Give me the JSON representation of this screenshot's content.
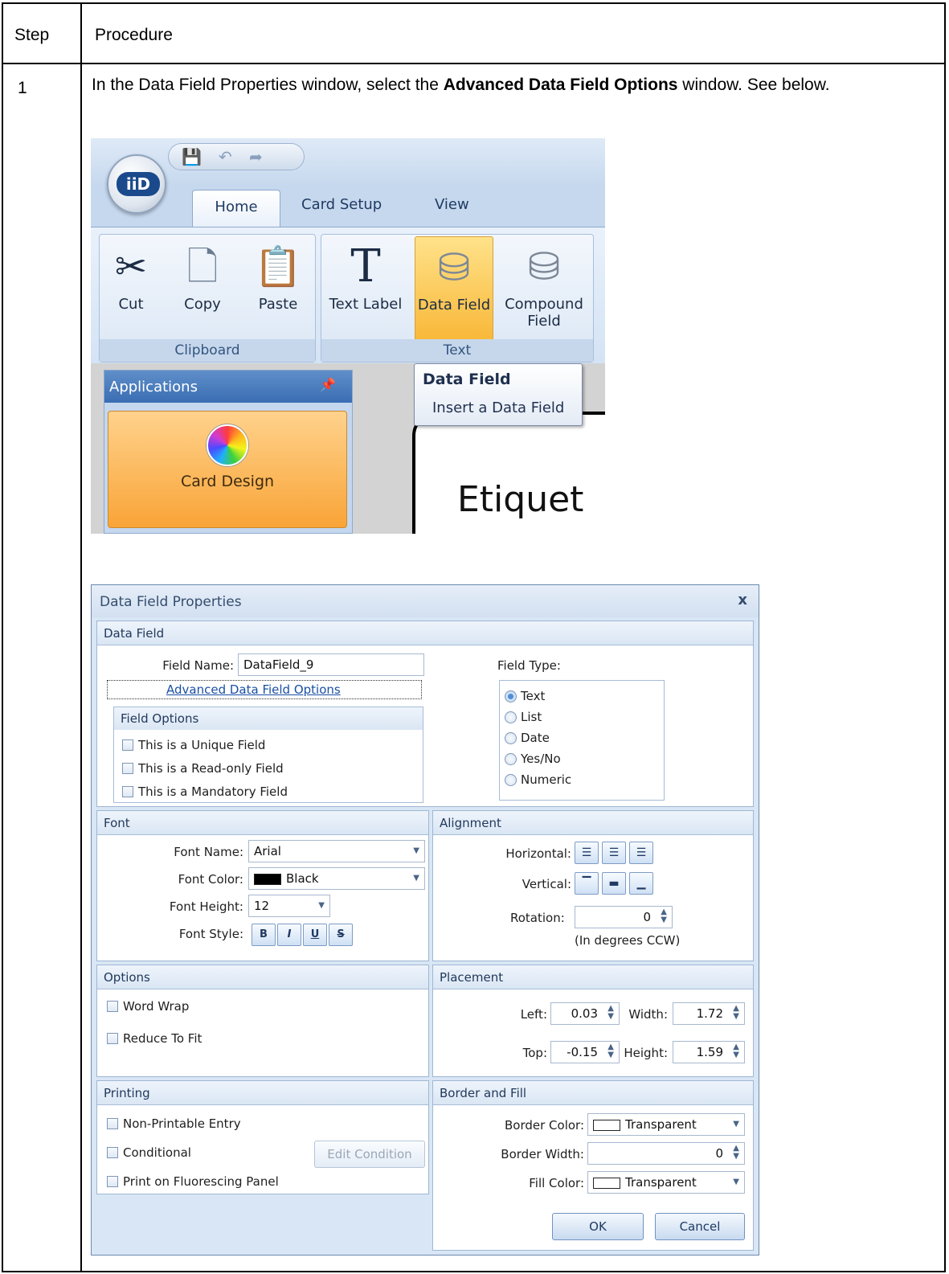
{
  "table": {
    "header_step": "Step",
    "header_procedure": "Procedure",
    "step_number": "1",
    "instruction_prefix": "In the Data Field Properties window, select the ",
    "instruction_bold": "Advanced Data Field Options",
    "instruction_suffix": " window. See below."
  },
  "ribbon": {
    "logo_text": "iiD",
    "tabs": [
      "Home",
      "Card Setup",
      "View"
    ],
    "clipboard": {
      "buttons": [
        {
          "label": "Cut",
          "icon": "scissors-icon"
        },
        {
          "label": "Copy",
          "icon": "copy-icon"
        },
        {
          "label": "Paste",
          "icon": "paste-icon"
        }
      ],
      "group_label": "Clipboard"
    },
    "text_group": {
      "buttons": [
        {
          "label": "Text Label",
          "icon": "text-label-icon"
        },
        {
          "label": "Data Field",
          "icon": "database-icon"
        },
        {
          "label": "Compound Field",
          "icon": "compound-field-icon"
        }
      ],
      "group_label": "Text"
    },
    "applications_title": "Applications",
    "card_design_label": "Card Design",
    "tooltip_title": "Data Field",
    "tooltip_body": "Insert a Data Field",
    "canvas_text": "Etiquet"
  },
  "dialog": {
    "title": "Data Field Properties",
    "close": "x",
    "data_field": {
      "header": "Data Field",
      "field_name_label": "Field Name:",
      "field_name_value": "DataField_9",
      "advanced_link": "Advanced Data Field Options",
      "field_options_header": "Field Options",
      "options": [
        "This is a Unique Field",
        "This is a Read-only Field",
        "This is a Mandatory Field"
      ],
      "field_type_label": "Field Type:",
      "field_types": [
        "Text",
        "List",
        "Date",
        "Yes/No",
        "Numeric"
      ],
      "field_type_selected": "Text"
    },
    "font": {
      "header": "Font",
      "name_label": "Font Name:",
      "name_value": "Arial",
      "color_label": "Font Color:",
      "color_value": "Black",
      "color_hex": "#000000",
      "height_label": "Font Height:",
      "height_value": "12",
      "style_label": "Font Style:",
      "styles": [
        "B",
        "I",
        "U",
        "S"
      ]
    },
    "alignment": {
      "header": "Alignment",
      "horizontal_label": "Horizontal:",
      "vertical_label": "Vertical:",
      "rotation_label": "Rotation:",
      "rotation_value": "0",
      "rotation_note": "(In degrees CCW)"
    },
    "options": {
      "header": "Options",
      "items": [
        "Word Wrap",
        "Reduce To Fit"
      ]
    },
    "placement": {
      "header": "Placement",
      "left_label": "Left:",
      "left_value": "0.03",
      "width_label": "Width:",
      "width_value": "1.72",
      "top_label": "Top:",
      "top_value": "-0.15",
      "height_label": "Height:",
      "height_value": "1.59"
    },
    "printing": {
      "header": "Printing",
      "items": [
        "Non-Printable Entry",
        "Conditional",
        "Print on Fluorescing Panel"
      ],
      "edit_condition": "Edit Condition"
    },
    "border_fill": {
      "header": "Border and Fill",
      "border_color_label": "Border Color:",
      "border_color_value": "Transparent",
      "border_width_label": "Border Width:",
      "border_width_value": "0",
      "fill_color_label": "Fill Color:",
      "fill_color_value": "Transparent"
    },
    "ok": "OK",
    "cancel": "Cancel"
  }
}
